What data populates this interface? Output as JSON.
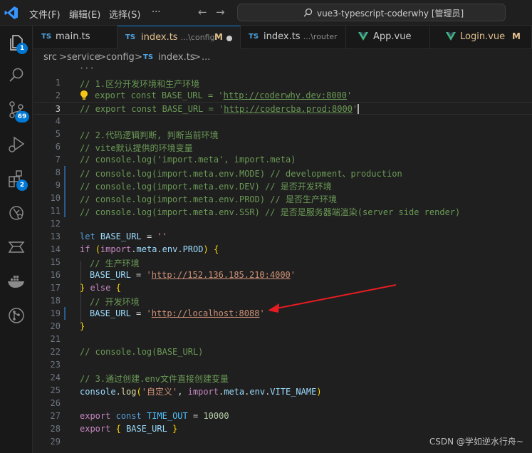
{
  "titlebar": {
    "menus": [
      "文件(F)",
      "编辑(E)",
      "选择(S)",
      "···"
    ],
    "command_center": "vue3-typescript-coderwhy [管理员]",
    "back_arrow": "←",
    "forward_arrow": "→"
  },
  "activity_bar": {
    "explorer_badge": "1",
    "scm_badge": "69",
    "extensions_badge": "2"
  },
  "tabs": [
    {
      "badge": "TS",
      "name": "main.ts",
      "hint": "",
      "status": ""
    },
    {
      "badge": "TS",
      "name": "index.ts",
      "hint": "...\\config",
      "status": "M"
    },
    {
      "badge": "TS",
      "name": "index.ts",
      "hint": "...\\router",
      "status": ""
    },
    {
      "badge": "vue-icon",
      "name": "App.vue",
      "hint": "",
      "status": ""
    },
    {
      "badge": "vue-icon",
      "name": "Login.vue",
      "hint": "",
      "status": "M"
    }
  ],
  "breadcrumb": {
    "parts": [
      "src",
      "service",
      "config"
    ],
    "separator": ">",
    "file_badge": "TS",
    "file": "index.ts",
    "ellipsis": "..."
  },
  "editor": {
    "sticky": "···",
    "line_numbers": [
      "1",
      "2",
      "3",
      "4",
      "5",
      "6",
      "7",
      "8",
      "9",
      "10",
      "11",
      "12",
      "13",
      "14",
      "15",
      "16",
      "17",
      "18",
      "19",
      "20",
      "21",
      "22",
      "23",
      "24",
      "25",
      "26",
      "27",
      "28",
      "29"
    ],
    "code": {
      "l1": "// 1.区分开发环境和生产环境",
      "l2a": "export const BASE_URL = '",
      "l2b": "http://coderwhy.dev:8000",
      "l2c": "'",
      "l3a": "// export const BASE_URL = '",
      "l3b": "http://codercba.prod:8000",
      "l3c": "'",
      "l5": "// 2.代码逻辑判断, 判断当前环境",
      "l6": "// vite默认提供的环境变量",
      "l7": "// console.log('import.meta', import.meta)",
      "l8": "// console.log(import.meta.env.MODE) // development、production",
      "l9": "// console.log(import.meta.env.DEV) // 是否开发环境",
      "l10": "// console.log(import.meta.env.PROD) // 是否生产环境",
      "l11": "// console.log(import.meta.env.SSR) // 是否是服务器端渲染(server side render)",
      "l13_kw": "let",
      "l13_var": "BASE_URL",
      "l13_op": " = ",
      "l13_str": "''",
      "l14_kw": "if",
      "l14_open": "(",
      "l14_imp": "import",
      "l14_dot1": ".",
      "l14_meta": "meta",
      "l14_dot2": ".",
      "l14_env": "env",
      "l14_dot3": ".",
      "l14_prod": "PROD",
      "l14_close": ")",
      "l14_brace": "{",
      "l15": "// 生产环境",
      "l16_var": "BASE_URL",
      "l16_op": " = ",
      "l16_q1": "'",
      "l16_url": "http://152.136.185.210:4000",
      "l16_q2": "'",
      "l17_b1": "}",
      "l17_kw": "else",
      "l17_b2": "{",
      "l18": "// 开发环境",
      "l19_var": "BASE_URL",
      "l19_op": " = ",
      "l19_q1": "'",
      "l19_url": "http://localhost:8088",
      "l19_q2": "'",
      "l20": "}",
      "l22": "// console.log(BASE_URL)",
      "l24": "// 3.通过创建.env文件直接创建变量",
      "l25_con": "console",
      "l25_dot": ".",
      "l25_fn": "log",
      "l25_open": "(",
      "l25_str": "'自定义'",
      "l25_comma": ", ",
      "l25_imp": "import",
      "l25_d1": ".",
      "l25_meta": "meta",
      "l25_d2": ".",
      "l25_env": "env",
      "l25_d3": ".",
      "l25_vite": "VITE_NAME",
      "l25_close": ")",
      "l27_kw": "export",
      "l27_kw2": "const",
      "l27_const": "TIME_OUT",
      "l27_op": " = ",
      "l27_num": "10000",
      "l28_kw": "export",
      "l28_b1": "{",
      "l28_var": "BASE_URL",
      "l28_b2": "}"
    }
  },
  "watermark": "CSDN @学如逆水行舟~",
  "colors": {
    "accent": "#0078d4",
    "arrow": "#e51c23"
  }
}
